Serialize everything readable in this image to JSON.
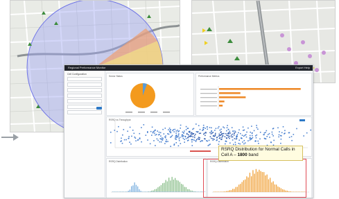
{
  "dashboard": {
    "topbar_title": "Regional Performance Monitor",
    "topbar_menu": "Export  Help",
    "sidebar_heading": "Cell Configuration",
    "pie_panel_title": "Sector Status",
    "bars_panel_title": "Performance Metrics",
    "scatter_panel_title": "RSRQ vs Throughput",
    "hist_left_title": "RSRQ Distribution",
    "hist_right_title": "RSRQ Distribution",
    "annotation_line1": "RSRQ Distribution for Normal Calls in",
    "annotation_line2_prefix": "Cell A – ",
    "annotation_line2_bold": "1800",
    "annotation_line2_suffix": " band"
  },
  "colors": {
    "pie_main": "#f39a1e",
    "pie_slice": "#5b9bd5",
    "bars": "#ee8a2a",
    "scatter": "#2f6fc9",
    "hist_green": "#8cbf8c",
    "highlight": "#e04a55",
    "coverage_circle": "#6f74e6"
  },
  "chart_data": [
    {
      "type": "pie",
      "values": [
        94,
        4,
        2
      ],
      "colors": [
        "#f39a1e",
        "#5b9bd5",
        "#d9534f"
      ]
    },
    {
      "type": "bar",
      "values": [
        92,
        24,
        30,
        6,
        4
      ]
    }
  ]
}
